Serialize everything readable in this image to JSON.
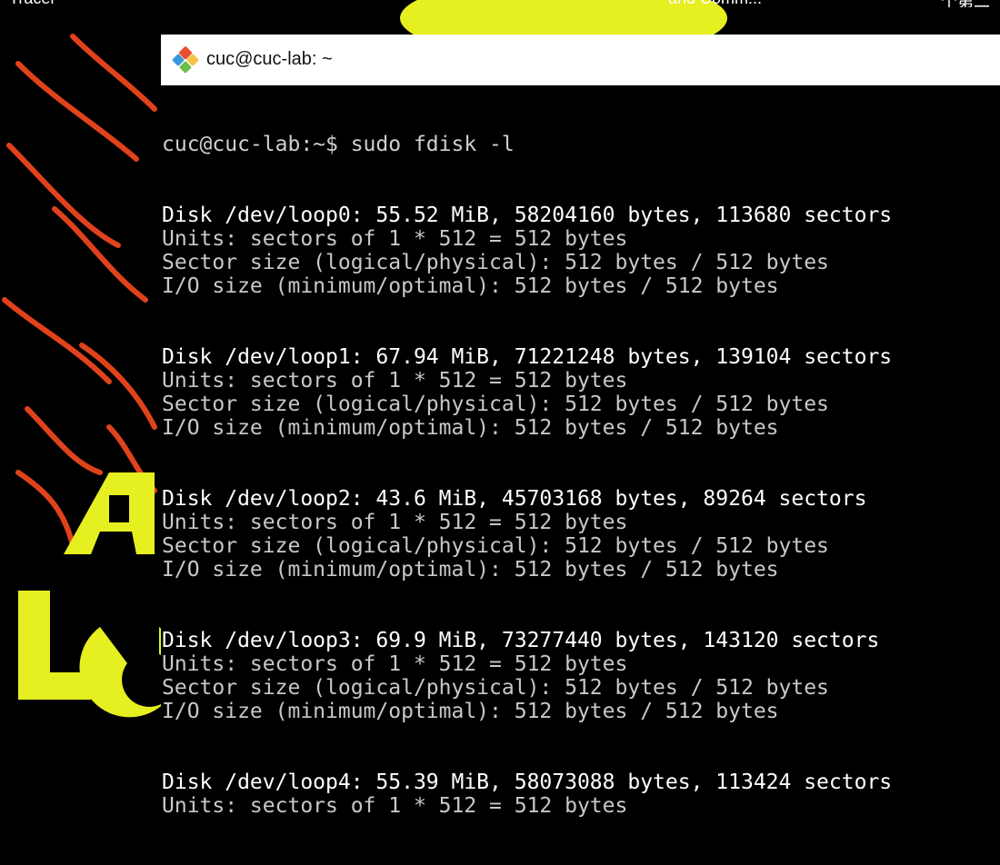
{
  "colors": {
    "wallpaper_bg": "#000000",
    "wallpaper_yellow": "#e6ef1f",
    "wallpaper_orange": "#e0421c",
    "terminal_bg": "#000000",
    "terminal_text": "#cfcfcf",
    "titlebar_bg": "#ffffff"
  },
  "window": {
    "title": "cuc@cuc-lab: ~",
    "icon": "git-bash-diamond-icon"
  },
  "taskbar": {
    "a": "Tracer",
    "b": "and Comm...",
    "c": "个第二"
  },
  "terminal": {
    "prompt": "cuc@cuc-lab:~$ sudo fdisk -l",
    "lines": [
      "Disk /dev/loop0: 55.52 MiB, 58204160 bytes, 113680 sectors",
      "Units: sectors of 1 * 512 = 512 bytes",
      "Sector size (logical/physical): 512 bytes / 512 bytes",
      "I/O size (minimum/optimal): 512 bytes / 512 bytes",
      "",
      "",
      "Disk /dev/loop1: 67.94 MiB, 71221248 bytes, 139104 sectors",
      "Units: sectors of 1 * 512 = 512 bytes",
      "Sector size (logical/physical): 512 bytes / 512 bytes",
      "I/O size (minimum/optimal): 512 bytes / 512 bytes",
      "",
      "",
      "Disk /dev/loop2: 43.6 MiB, 45703168 bytes, 89264 sectors",
      "Units: sectors of 1 * 512 = 512 bytes",
      "Sector size (logical/physical): 512 bytes / 512 bytes",
      "I/O size (minimum/optimal): 512 bytes / 512 bytes",
      "",
      "",
      "Disk /dev/loop3: 69.9 MiB, 73277440 bytes, 143120 sectors",
      "Units: sectors of 1 * 512 = 512 bytes",
      "Sector size (logical/physical): 512 bytes / 512 bytes",
      "I/O size (minimum/optimal): 512 bytes / 512 bytes",
      "",
      "",
      "Disk /dev/loop4: 55.39 MiB, 58073088 bytes, 113424 sectors",
      "Units: sectors of 1 * 512 = 512 bytes"
    ]
  }
}
